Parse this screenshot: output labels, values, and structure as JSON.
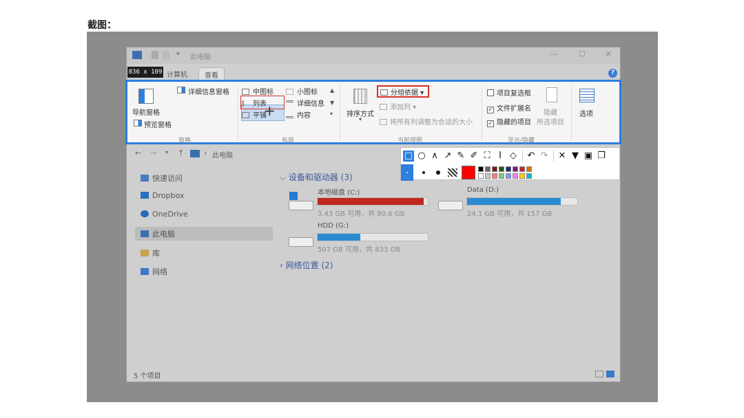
{
  "caption": "截图：",
  "window": {
    "title": "此电脑",
    "size_badge": "836 x 109",
    "tabs": [
      "计算机",
      "查看"
    ],
    "help": "?"
  },
  "ribbon": {
    "panes": {
      "nav_pane": "导航窗格",
      "preview_pane": "预览窗格",
      "details_pane": "详细信息窗格",
      "group": "窗格"
    },
    "layout": {
      "items": [
        "中图标",
        "小图标",
        "列表",
        "详细信息",
        "平铺",
        "内容"
      ],
      "group": "布局"
    },
    "current_view": {
      "sort": "排序方式",
      "group_by": "分组依据",
      "add_column": "添加列",
      "fit_columns": "将所有列调整为合适的大小",
      "group": "当前视图"
    },
    "show_hide": {
      "item_checkbox": "项目复选框",
      "extensions": "文件扩展名",
      "hidden_items": "隐藏的项目",
      "hide": "隐藏",
      "selected_items": "所选项目",
      "group": "显示/隐藏"
    },
    "options": "选项"
  },
  "nav": {
    "back": "←",
    "forward": "→",
    "up": "↑",
    "path": "此电脑"
  },
  "sidebar": {
    "items": [
      "快速访问",
      "Dropbox",
      "OneDrive",
      "此电脑",
      "库",
      "网络"
    ]
  },
  "content": {
    "devices_header": "设备和驱动器 (3)",
    "network_header": "网络位置 (2)",
    "drives": [
      {
        "name": "本地磁盘 (C:)",
        "info": "3.43 GB 可用，共 80.6 GB",
        "used": 0.96,
        "color": "#c0281e"
      },
      {
        "name": "Data (D:)",
        "info": "24.1 GB 可用，共 157 GB",
        "used": 0.85,
        "color": "#2a8bd0"
      },
      {
        "name": "HDD (G:)",
        "info": "507 GB 可用，共 833 GB",
        "used": 0.39,
        "color": "#2a8bd0"
      }
    ]
  },
  "statusbar": "5 个项目",
  "palette": [
    "#000000",
    "#6b6b6b",
    "#7a1a1a",
    "#1a5a1a",
    "#1a2a7a",
    "#7a1a7a",
    "#c02828",
    "#d07a00",
    "#ffffff",
    "#c8c8c8",
    "#ff7a7a",
    "#7ad07a",
    "#7a9aff",
    "#ff7aff",
    "#ffd000",
    "#00c0c0"
  ],
  "current_color": "#ff0000"
}
